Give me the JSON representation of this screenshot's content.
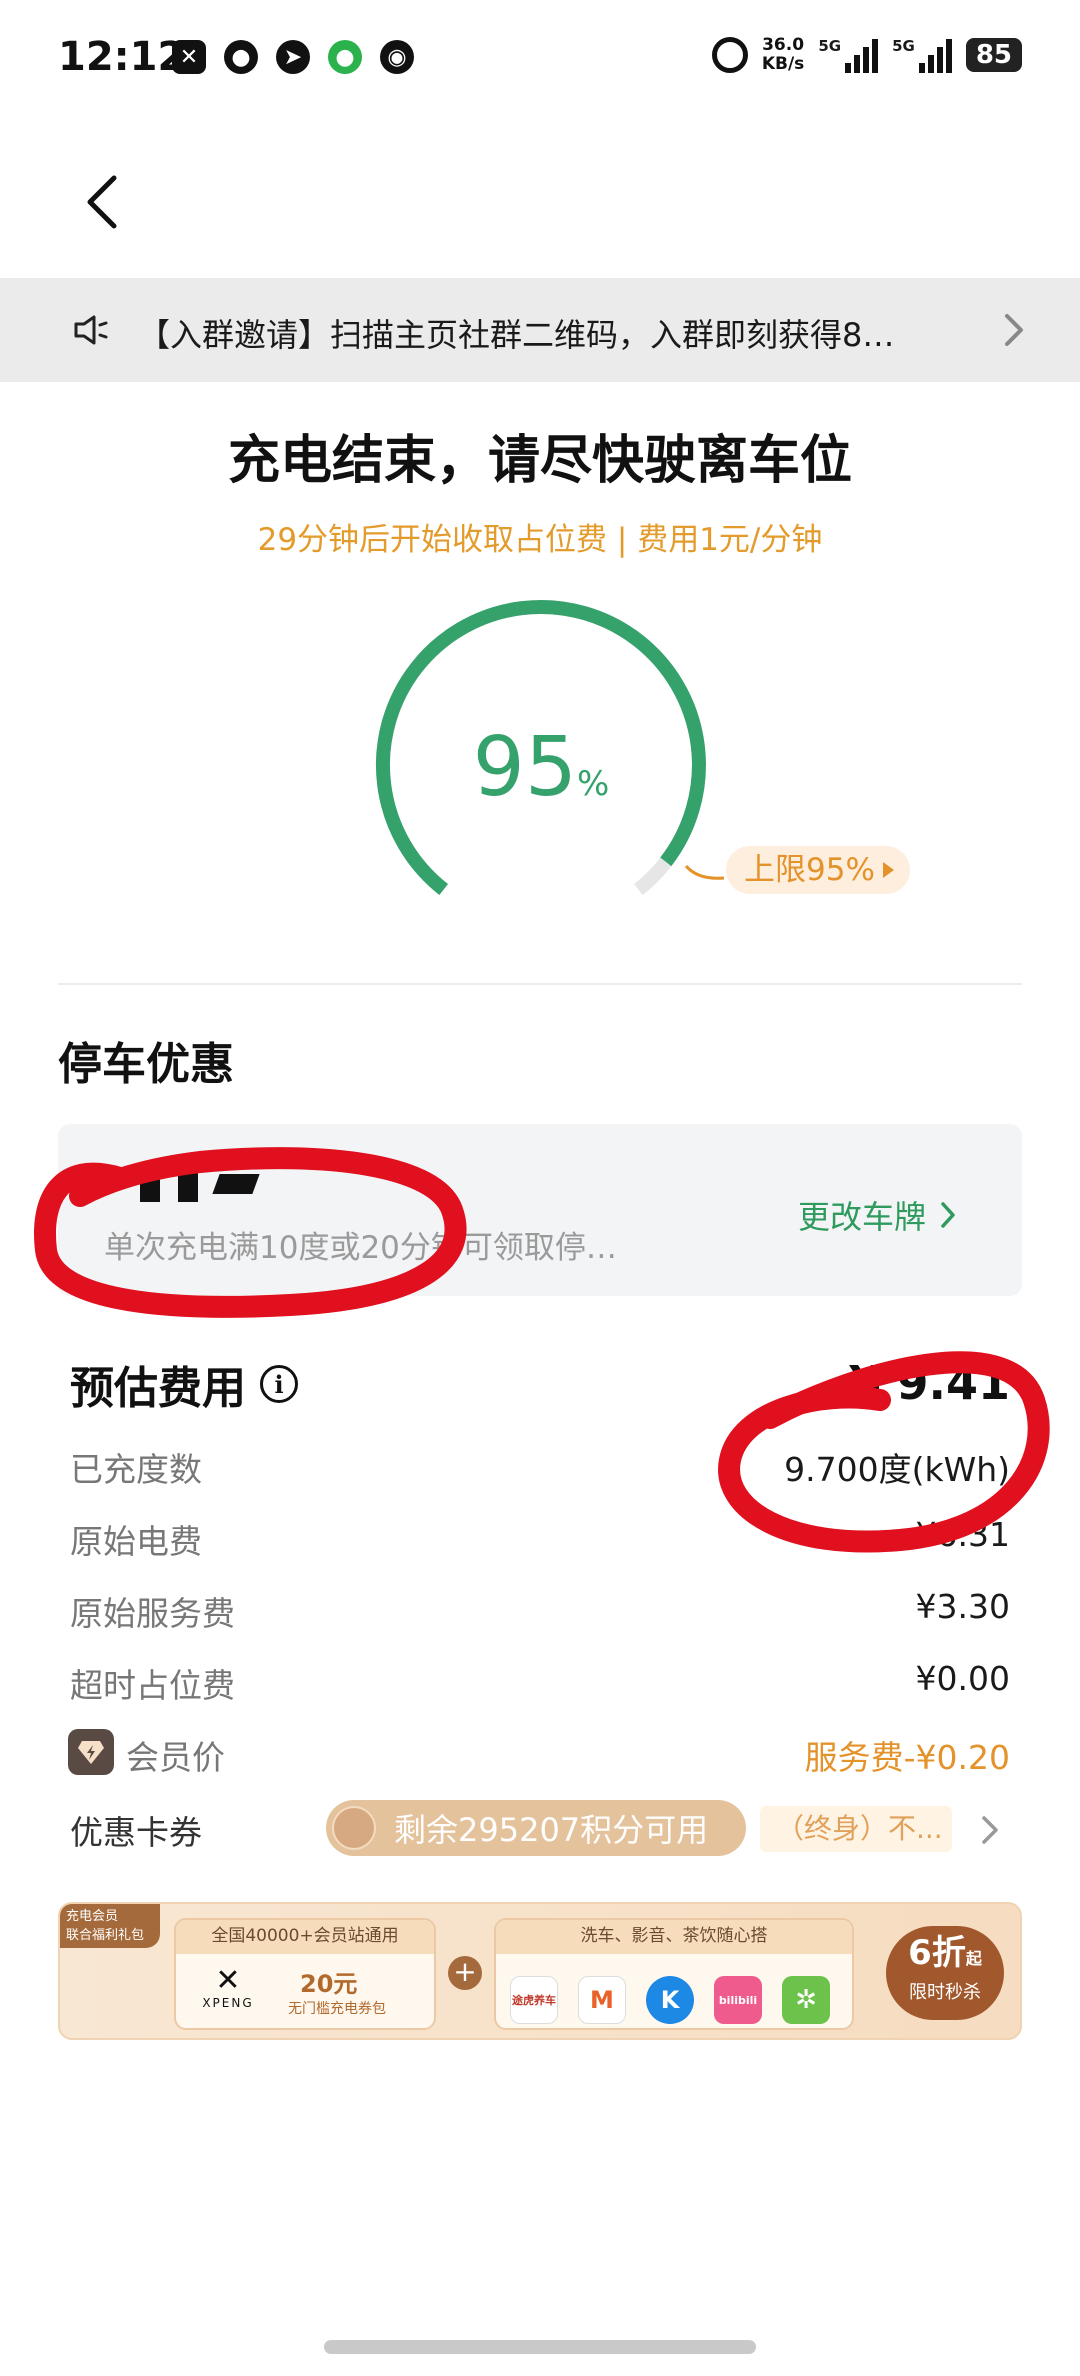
{
  "status_bar": {
    "time": "12:12",
    "network_speed_value": "36.0",
    "network_speed_unit": "KB/s",
    "signal_1_label": "5G",
    "signal_2_label": "5G",
    "battery": "85"
  },
  "notice": {
    "text": "【入群邀请】扫描主页社群二维码，入群即刻获得8…"
  },
  "charging": {
    "title": "充电结束，请尽快驶离车位",
    "subtitle": "29分钟后开始收取占位费 | 费用1元/分钟",
    "percent_value": "95",
    "percent_unit": "%",
    "percent_fraction": 0.95,
    "limit_label": "上限95%"
  },
  "parking": {
    "section_title": "停车优惠",
    "hint": "单次充电满10度或20分钟可领取停…",
    "change_plate_label": "更改车牌"
  },
  "fees": {
    "title": "预估费用",
    "total": "¥ 9.41",
    "rows": [
      {
        "label": "已充度数",
        "value": "9.700度(kWh)"
      },
      {
        "label": "原始电费",
        "value": "¥6.31"
      },
      {
        "label": "原始服务费",
        "value": "¥3.30"
      },
      {
        "label": "超时占位费",
        "value": "¥0.00"
      }
    ],
    "member_label": "会员价",
    "member_value": "服务费-¥0.20",
    "coupon_label": "优惠卡券",
    "points_text": "剩余295207积分可用",
    "lifetime_text": "（终身）不..."
  },
  "banner": {
    "tag_line1": "充电会员",
    "tag_line2": "联合福利礼包",
    "box1_head": "全国40000+会员站通用",
    "logo_text": "XPENG",
    "coupon_amount": "20元",
    "coupon_desc": "无门槛充电券包",
    "box2_head": "洗车、影音、茶饮随心搭",
    "partners": [
      "途虎养车",
      "M",
      "K",
      "bilibili",
      "✲"
    ],
    "sale_big": "6折",
    "sale_suffix": "起",
    "sale_small": "限时秒杀"
  },
  "colors": {
    "accent_green": "#35a26c",
    "accent_orange": "#e4922a",
    "annotation_red": "#e0101e"
  },
  "icons": {
    "back": "chevron-left-icon",
    "notice": "speaker-icon",
    "notice_arrow": "chevron-right-icon",
    "info": "info-icon",
    "member": "diamond-bolt-icon"
  }
}
